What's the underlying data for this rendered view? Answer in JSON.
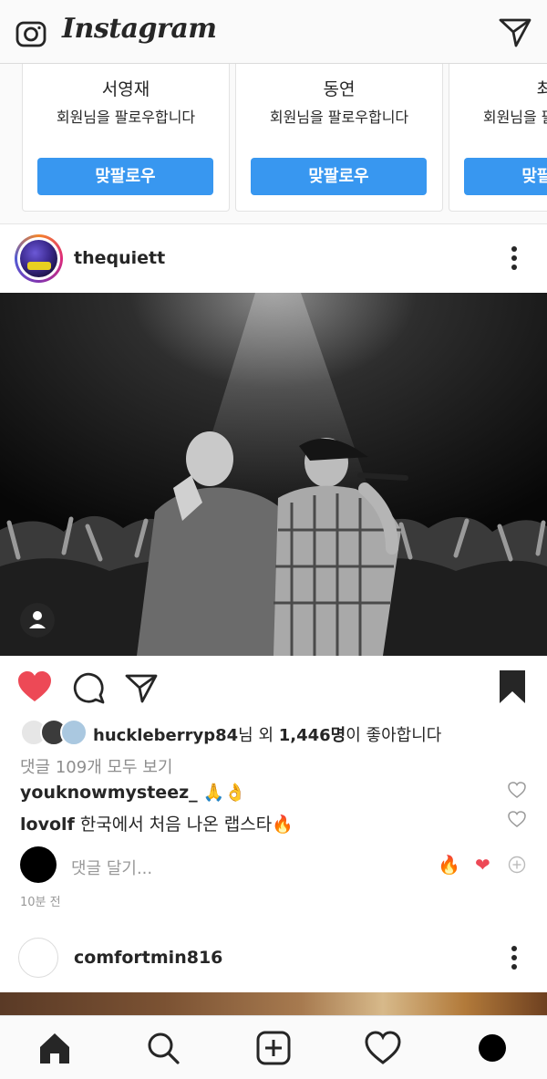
{
  "header": {
    "logo": "Instagram",
    "camera_icon": "camera-icon",
    "direct_icon": "paper-plane-icon"
  },
  "suggestions": [
    {
      "name": "서영재",
      "subtitle": "회원님을 팔로우합니다",
      "button": "맞팔로우"
    },
    {
      "name": "동연",
      "subtitle": "회원님을 팔로우합니다",
      "button": "맞팔로우"
    },
    {
      "name": "최영",
      "subtitle": "회원님을 팔로우합니다",
      "button": "맞팔로우"
    }
  ],
  "post": {
    "username": "thequiett",
    "liked": true,
    "likes": {
      "user": "huckleberryp84",
      "mid": "님 외 ",
      "count": "1,446명",
      "suffix": "이 좋아합니다"
    },
    "view_comments": "댓글 109개 모두 보기",
    "comments": [
      {
        "user": "youknowmysteez_",
        "text": "🙏👌"
      },
      {
        "user": "lovolf",
        "text": "한국에서 처음 나온 랩스타🔥"
      }
    ],
    "add_comment_placeholder": "댓글 달기...",
    "quick_reactions": [
      "🔥",
      "❤"
    ],
    "time": "10분 전"
  },
  "next_post": {
    "username": "comfortmin816"
  },
  "colors": {
    "accent": "#3897f0",
    "like": "#ed4956",
    "muted": "#8e8e8e"
  },
  "nav": [
    "home-icon",
    "search-icon",
    "new-post-icon",
    "activity-heart-icon",
    "profile-icon"
  ]
}
